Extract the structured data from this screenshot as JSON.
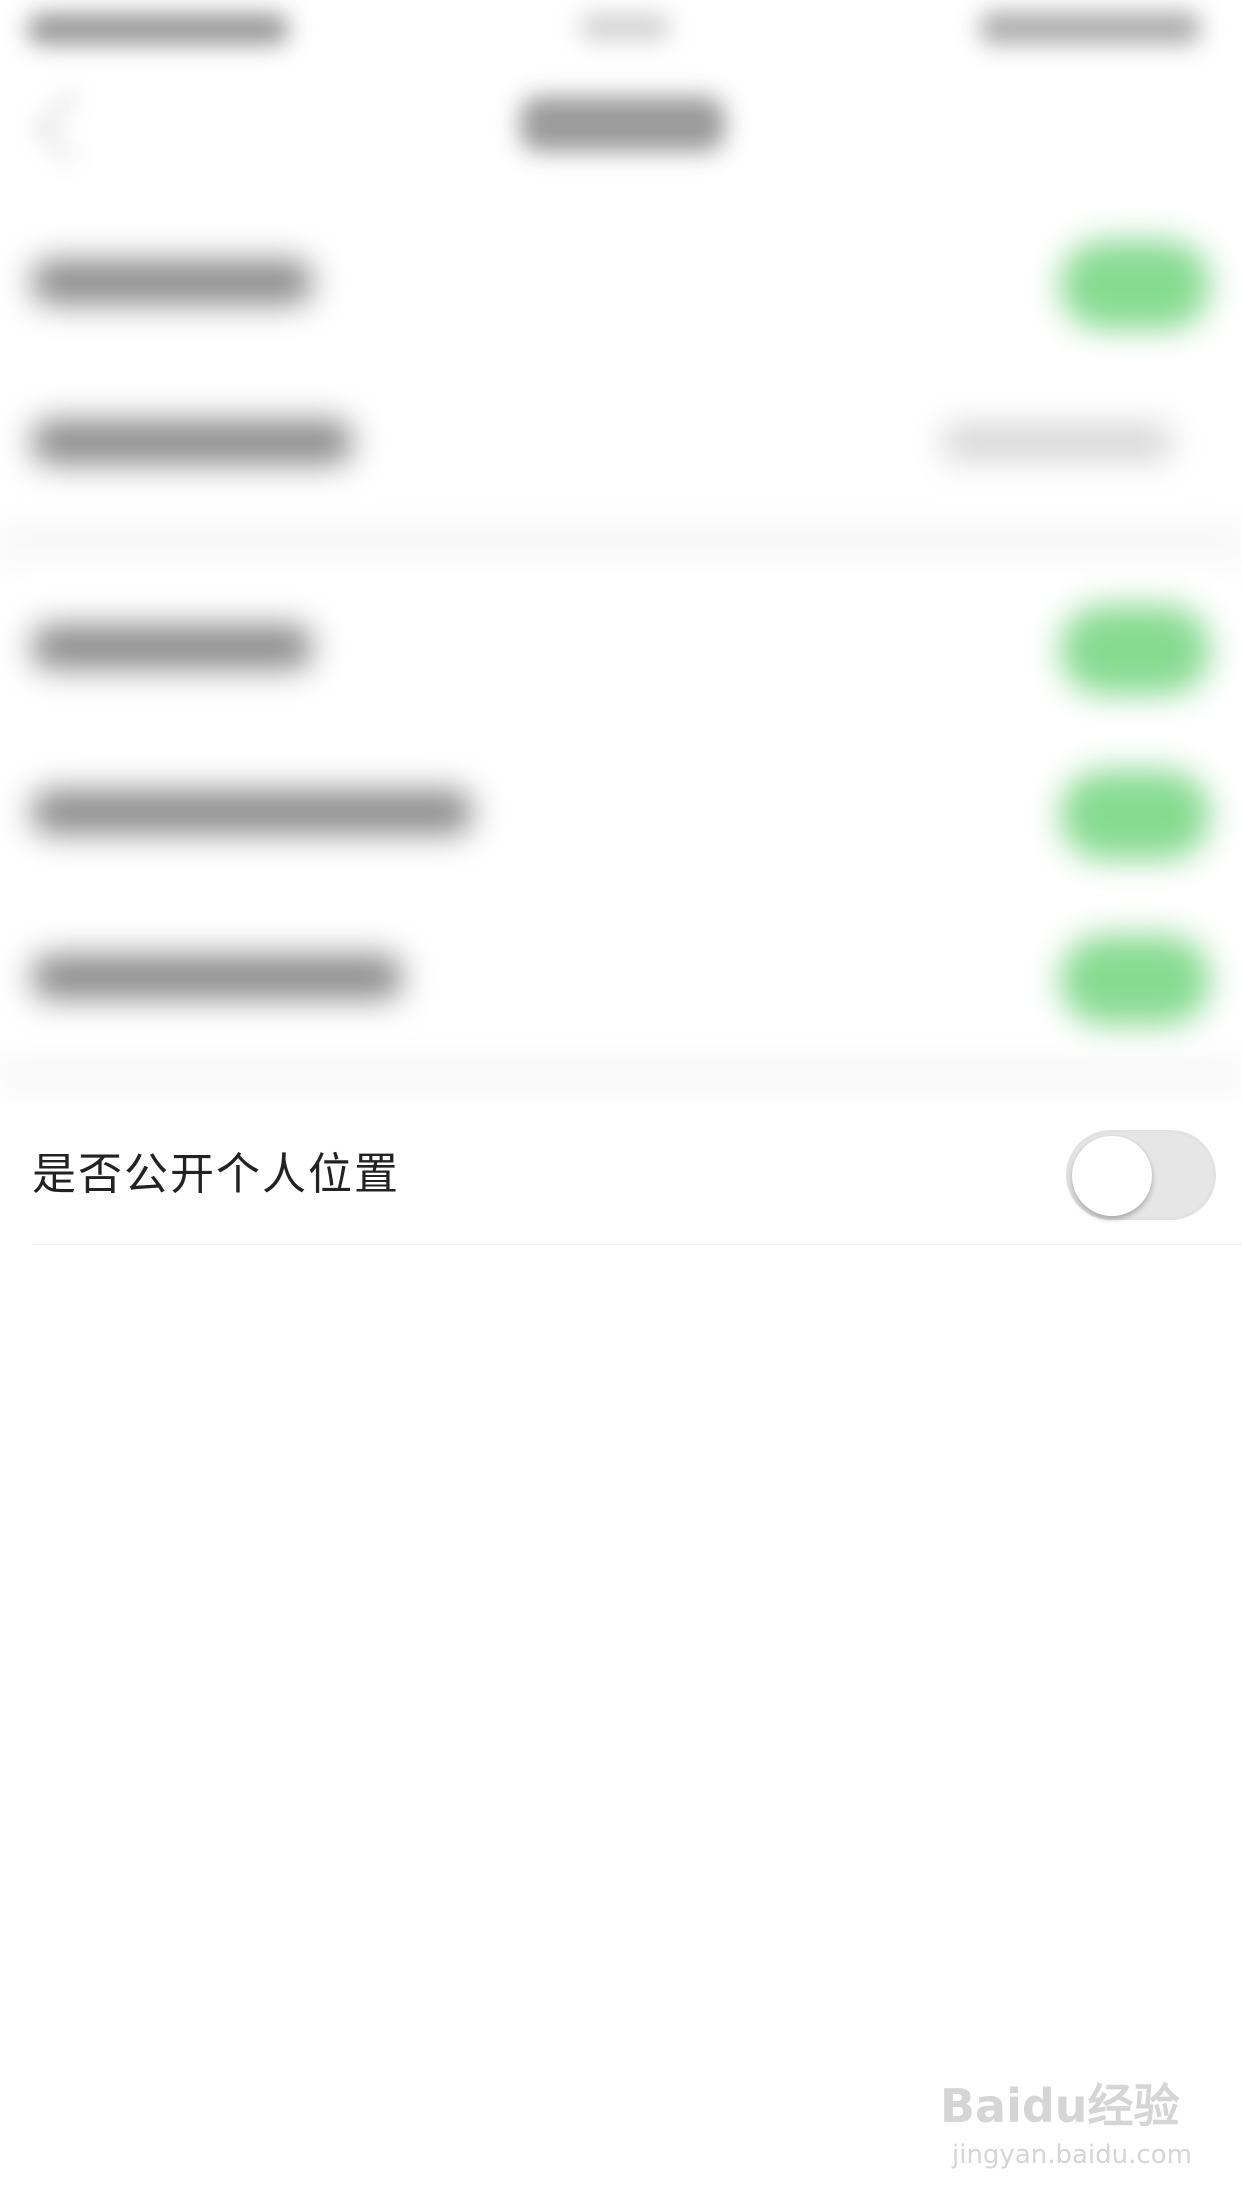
{
  "settings": {
    "public_location": {
      "label": "是否公开个人位置",
      "enabled": false
    }
  },
  "colors": {
    "toggle_on": "#5fcf6c",
    "toggle_off": "#e6e6e6",
    "text": "#222222"
  },
  "watermark": {
    "logo": "Baidu经验",
    "url": "jingyan.baidu.com"
  }
}
